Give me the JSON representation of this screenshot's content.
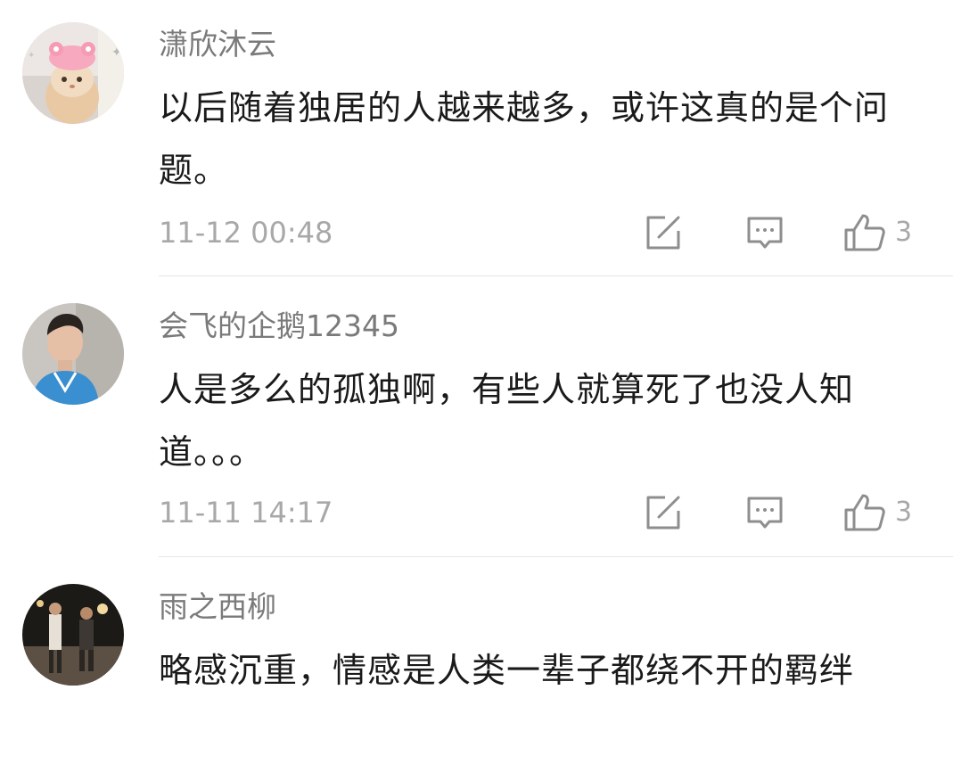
{
  "comments": [
    {
      "username": "潇欣沐云",
      "text": "以后随着独居的人越来越多，或许这真的是个问题。",
      "timestamp": "11-12 00:48",
      "likes": "3",
      "avatar": "cat-with-pink-hat"
    },
    {
      "username": "会飞的企鹅12345",
      "text": "人是多么的孤独啊，有些人就算死了也没人知道。。。",
      "timestamp": "11-11 14:17",
      "likes": "3",
      "avatar": "young-man-portrait"
    },
    {
      "username": "雨之西柳",
      "text": "略感沉重，情感是人类一辈子都绕不开的羁绊",
      "avatar": "night-street-people"
    }
  ]
}
